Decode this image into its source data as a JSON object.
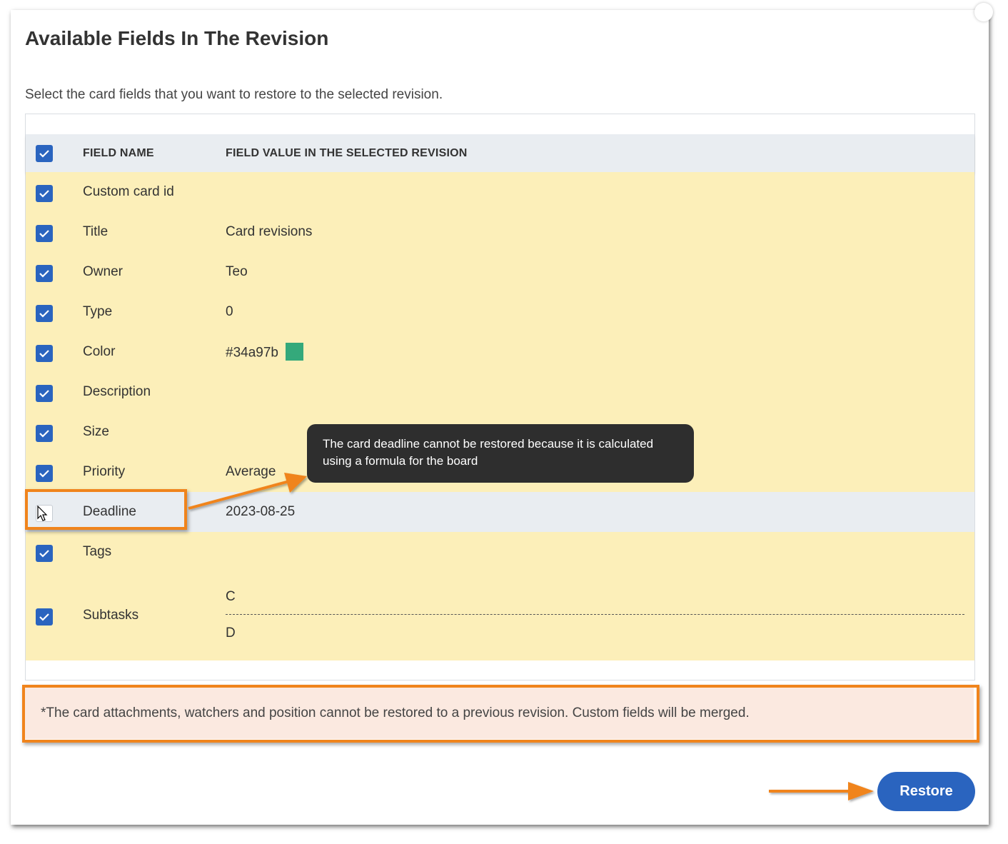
{
  "dialog": {
    "title": "Available Fields In The Revision",
    "subtitle": "Select the card fields that you want to restore to the selected revision."
  },
  "table": {
    "headers": {
      "field_name": "FIELD NAME",
      "field_value": "FIELD VALUE IN THE SELECTED REVISION"
    },
    "select_all_checked": true,
    "rows": [
      {
        "name": "Custom card id",
        "value": "",
        "checked": true
      },
      {
        "name": "Title",
        "value": "Card revisions",
        "checked": true
      },
      {
        "name": "Owner",
        "value": "Teo",
        "checked": true
      },
      {
        "name": "Type",
        "value": "0",
        "checked": true
      },
      {
        "name": "Color",
        "value": "#34a97b",
        "swatch_color": "#34a97b",
        "checked": true
      },
      {
        "name": "Description",
        "value": "",
        "checked": true
      },
      {
        "name": "Size",
        "value": "",
        "checked": true
      },
      {
        "name": "Priority",
        "value": "Average",
        "checked": true
      },
      {
        "name": "Deadline",
        "value": "2023-08-25",
        "checked": false
      },
      {
        "name": "Tags",
        "value": "",
        "checked": true
      },
      {
        "name": "Subtasks",
        "values": [
          "C",
          "D"
        ],
        "checked": true
      }
    ]
  },
  "tooltip": {
    "text": "The card deadline cannot be restored because it is calculated using a formula for the board"
  },
  "notice": {
    "text": "*The card attachments, watchers and position cannot be restored to a previous revision. Custom fields will be merged."
  },
  "actions": {
    "restore_label": "Restore"
  },
  "colors": {
    "accent": "#2a64bf",
    "row_highlight": "#fcefb9",
    "row_disabled": "#e9edf1",
    "annotation": "#f0841c",
    "tooltip_bg": "#2e2e2e",
    "notice_bg": "#fbe9e0"
  }
}
